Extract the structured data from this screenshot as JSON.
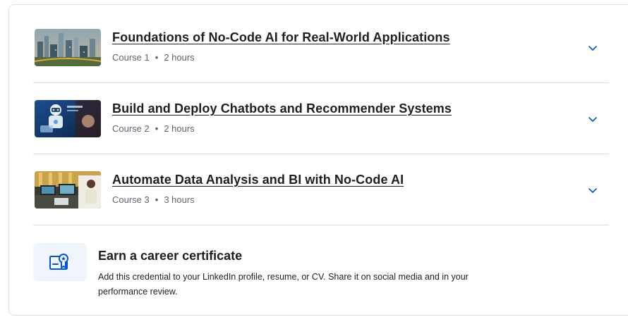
{
  "courses": [
    {
      "title": "Foundations of No-Code AI for Real-World Applications",
      "course_label": "Course 1",
      "duration": "2 hours",
      "thumbnail": "city-skyline-thumbnail"
    },
    {
      "title": "Build and Deploy Chatbots and Recommender Systems",
      "course_label": "Course 2",
      "duration": "2 hours",
      "thumbnail": "robot-chatbot-thumbnail"
    },
    {
      "title": "Automate Data Analysis and BI with No-Code AI",
      "course_label": "Course 3",
      "duration": "3 hours",
      "thumbnail": "office-dashboard-thumbnail"
    }
  ],
  "meta_separator": "•",
  "certificate": {
    "title": "Earn a career certificate",
    "description": "Add this credential to your LinkedIn profile, resume, or CV. Share it on social media and in your performance review.",
    "icon": "certificate-icon"
  },
  "colors": {
    "accent": "#0056d2",
    "muted_text": "#5b6670",
    "divider": "#dcdee2",
    "icon_box_bg": "#f0f4fb"
  }
}
